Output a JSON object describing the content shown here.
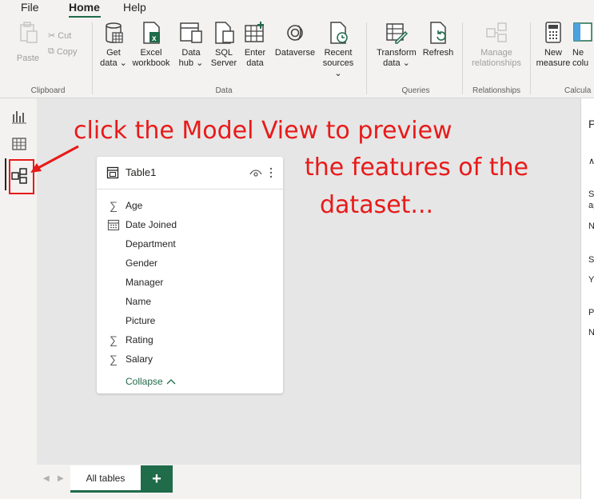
{
  "menu": {
    "file": "File",
    "home": "Home",
    "help": "Help"
  },
  "ribbon": {
    "clipboard": {
      "paste": "Paste",
      "cut": "Cut",
      "copy": "Copy",
      "group": "Clipboard"
    },
    "data": {
      "get_data": [
        "Get",
        "data ⌄"
      ],
      "excel": [
        "Excel",
        "workbook"
      ],
      "data_hub": [
        "Data",
        "hub ⌄"
      ],
      "sql": [
        "SQL",
        "Server"
      ],
      "enter_data": [
        "Enter",
        "data"
      ],
      "dataverse": "Dataverse",
      "recent": [
        "Recent",
        "sources ⌄"
      ],
      "group": "Data"
    },
    "queries": {
      "transform": [
        "Transform",
        "data ⌄"
      ],
      "refresh": "Refresh",
      "group": "Queries"
    },
    "relationships": {
      "manage": [
        "Manage",
        "relationships"
      ],
      "group": "Relationships"
    },
    "calculations": {
      "new_measure": [
        "New",
        "measure"
      ],
      "new_column": [
        "Ne",
        "colu"
      ],
      "group": "Calcula"
    }
  },
  "table": {
    "title": "Table1",
    "fields": [
      {
        "name": "Age",
        "icon": "sigma-icon"
      },
      {
        "name": "Date Joined",
        "icon": "calendar-icon"
      },
      {
        "name": "Department",
        "icon": ""
      },
      {
        "name": "Gender",
        "icon": ""
      },
      {
        "name": "Manager",
        "icon": ""
      },
      {
        "name": "Name",
        "icon": ""
      },
      {
        "name": "Picture",
        "icon": ""
      },
      {
        "name": "Rating",
        "icon": "sigma-icon"
      },
      {
        "name": "Salary",
        "icon": "sigma-icon"
      }
    ],
    "collapse": "Collapse"
  },
  "annotation": {
    "line1": "click the Model View to preview",
    "line2": "the features of the",
    "line3": "dataset..."
  },
  "right_panel": {
    "t1": "P",
    "t2": "∧",
    "t3": "Sl",
    "t4": "ap",
    "t5": "N",
    "t6": "Sl",
    "t7": "Y",
    "t8": "Pi",
    "t9": "N"
  },
  "bottom": {
    "tab": "All tables",
    "add": "+"
  },
  "colors": {
    "accent": "#1f6b4a",
    "annotation": "#e81a1a"
  }
}
